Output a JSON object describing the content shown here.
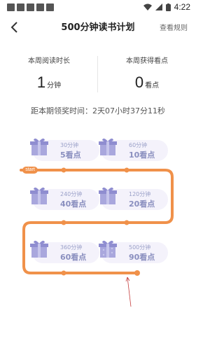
{
  "status": {
    "time": "4:22"
  },
  "header": {
    "title": "500分钟读书计划",
    "rules_link": "查看规则"
  },
  "stats": {
    "week_read": {
      "label": "本周阅读时长",
      "value": "1",
      "unit": "分钟"
    },
    "week_points": {
      "label": "本周获得看点",
      "value": "0",
      "unit": "看点"
    }
  },
  "countdown": "距本期领奖时间：2天07小时37分11秒",
  "track": {
    "start_label": "start"
  },
  "rewards": [
    {
      "minutes": "30分钟",
      "points": "5看点"
    },
    {
      "minutes": "60分钟",
      "points": "10看点"
    },
    {
      "minutes": "240分钟",
      "points": "40看点"
    },
    {
      "minutes": "120分钟",
      "points": "20看点"
    },
    {
      "minutes": "360分钟",
      "points": "60看点"
    },
    {
      "minutes": "500分钟",
      "points": "90看点"
    }
  ],
  "colors": {
    "track": "#f0914a",
    "card_bg": "#f4f2fb",
    "gift": "#a9a7dd"
  }
}
